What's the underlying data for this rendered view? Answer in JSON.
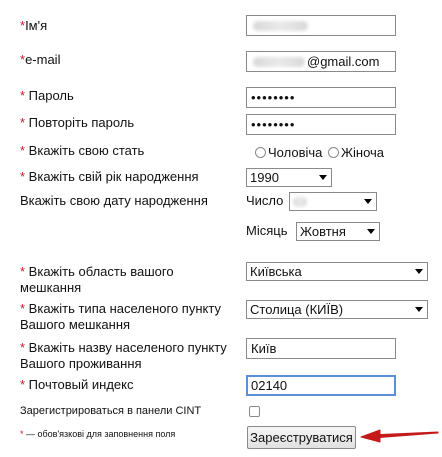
{
  "form": {
    "name": {
      "required_mark": "*",
      "label": "Ім'я"
    },
    "email": {
      "required_mark": "*",
      "label": "e-mail",
      "value_suffix": "@gmail.com"
    },
    "password": {
      "required_mark": "*",
      "label": " Пароль",
      "value": "••••••••"
    },
    "password_repeat": {
      "required_mark": "*",
      "label": " Повторіть пароль",
      "value": "••••••••"
    },
    "gender": {
      "required_mark": "*",
      "label": " Вкажіть свою стать",
      "options": [
        "Чоловіча",
        "Жіноча"
      ]
    },
    "birth_year": {
      "required_mark": "*",
      "label": " Вкажіть свій рік народження",
      "selected": "1990"
    },
    "birth_date": {
      "label": "Вкажіть свою дату народження",
      "day_label": "Число",
      "month_label": "Місяць",
      "month_selected": "Жовтня"
    },
    "region": {
      "required_mark": "*",
      "label_line1": " Вкажіть область вашого",
      "label_line2": "мешкання",
      "selected": "Київська"
    },
    "settlement_type": {
      "required_mark": "*",
      "label_line1": " Вкажіть типа населеного пункту",
      "label_line2": "Вашого мешкання",
      "selected": "Столица (КИЇВ)"
    },
    "settlement_name": {
      "required_mark": "*",
      "label_line1": " Вкажіть назву населеного пункту",
      "label_line2": "Вашого проживання",
      "value": "Київ"
    },
    "postal_code": {
      "required_mark": "*",
      "label": " Почтовый индекс",
      "value": "02140"
    },
    "cint_panel": {
      "label": "Зарегистрироваться в панели CINT"
    },
    "footnote": {
      "mark": "*",
      "text": " — обов'язкові для заповнення поля"
    },
    "submit_label": "Зареєструватися"
  },
  "colors": {
    "required": "#d0191a",
    "arrow": "#c41a1a",
    "focus": "#5b8fd6"
  }
}
